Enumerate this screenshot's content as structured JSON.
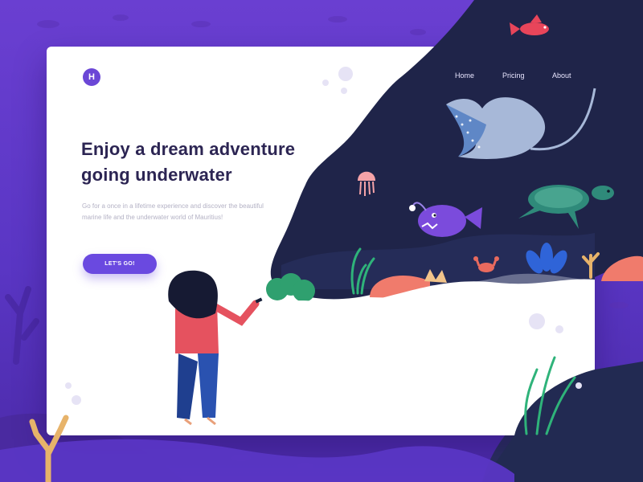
{
  "brand": {
    "logo_letter": "H"
  },
  "nav": {
    "items": [
      "Home",
      "Pricing",
      "About"
    ]
  },
  "hero": {
    "title_line1": "Enjoy a dream adventure",
    "title_line2": "going underwater",
    "description": "Go for a once in a lifetime experience and discover the beautiful marine life and the underwater world of Mauritius!",
    "cta_label": "LET'S GO!"
  },
  "colors": {
    "background": "#5a36c4",
    "ocean": "#1f2449",
    "accent": "#6a49e0",
    "heading": "#2c2553"
  }
}
